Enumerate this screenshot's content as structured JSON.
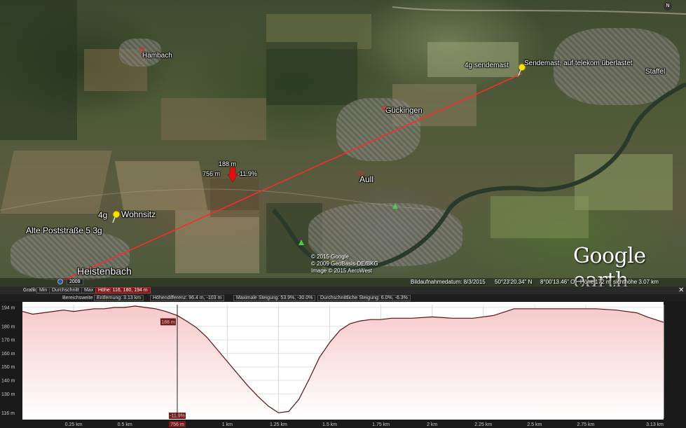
{
  "map": {
    "places": {
      "hambach": "Hambach",
      "gueckingen": "Gückingen",
      "aull": "Aull",
      "heistenbach": "Heistenbach",
      "staffel": "Staffel"
    },
    "placemarks": {
      "sendemast_small": "4g sendemast",
      "sendemast": "Sendemast, auf telekom überlastet",
      "wohnsitz_prefix": "4g",
      "wohnsitz": "Wohnsitz",
      "poststrasse": "Alte Poststraße 5 3g"
    },
    "cursor": {
      "height": "188 m",
      "distance": "756 m",
      "slope": "-11.9%"
    },
    "copyright": [
      "© 2015 Google",
      "© 2009 GeoBasis-DE/BKG",
      "Image © 2015 AeroWest"
    ],
    "logo": "Google earth",
    "north": "N",
    "year_badge": "2009",
    "status": {
      "date": "Bildaufnahmedatum: 8/3/2015",
      "lat": "50°23'20.34\" N",
      "lon": "8°00'13.46\" O",
      "elev": "Höhe  172 m",
      "eye": "sichthöhe    3.07 km"
    }
  },
  "profile": {
    "toolbar1": {
      "grafik": "Grafik:",
      "min": "Min",
      "avg": "Durchschnitt",
      "max": "Max",
      "hoehe": "Höhe: 116, 180, 194 m"
    },
    "toolbar2": {
      "bereich": "Bereichsweite",
      "entfernung": "Entfernung: 3.13 km",
      "hoehendiff": "Höhendifferenz: 96.4 m, -103 m",
      "maxsteigung": "Maximale Steigung: 53.9%, -30.0%",
      "avgsteigung": "Durchschnittliche Steigung: 6.0%, -6.3%"
    },
    "close": "✕",
    "cursor_height_label": "188 m",
    "cursor_distance_label": "756 m",
    "cursor_slope_label": "-11.9%"
  },
  "chart_data": {
    "type": "area",
    "title": "",
    "xlabel": "",
    "ylabel": "",
    "xlim": [
      0,
      3.13
    ],
    "ylim": [
      112,
      196
    ],
    "y_ticks": [
      {
        "v": 194,
        "label": "194 m"
      },
      {
        "v": 180,
        "label": "180 m"
      },
      {
        "v": 170,
        "label": "170 m"
      },
      {
        "v": 160,
        "label": "160 m"
      },
      {
        "v": 150,
        "label": "150 m"
      },
      {
        "v": 140,
        "label": "140 m"
      },
      {
        "v": 130,
        "label": "130 m"
      },
      {
        "v": 116,
        "label": "116 m"
      }
    ],
    "x_ticks": [
      {
        "v": 0.25,
        "label": "0.25 km"
      },
      {
        "v": 0.5,
        "label": "0.5 km"
      },
      {
        "v": 0.756,
        "label": "756 m"
      },
      {
        "v": 1.0,
        "label": "1 km"
      },
      {
        "v": 1.25,
        "label": "1.25 km"
      },
      {
        "v": 1.5,
        "label": "1.5 km"
      },
      {
        "v": 1.75,
        "label": "1.75 km"
      },
      {
        "v": 2.0,
        "label": "2 km"
      },
      {
        "v": 2.25,
        "label": "2.25 km"
      },
      {
        "v": 2.5,
        "label": "2.5 km"
      },
      {
        "v": 2.75,
        "label": "2.75 km"
      },
      {
        "v": 3.13,
        "label": "3.13 km"
      }
    ],
    "cursor_x": 0.756,
    "series": [
      {
        "x": [
          0,
          0.05,
          0.1,
          0.15,
          0.2,
          0.25,
          0.3,
          0.35,
          0.4,
          0.45,
          0.5,
          0.55,
          0.6,
          0.65,
          0.7,
          0.756,
          0.8,
          0.85,
          0.9,
          0.95,
          1.0,
          1.05,
          1.1,
          1.15,
          1.2,
          1.25,
          1.3,
          1.35,
          1.4,
          1.45,
          1.5,
          1.55,
          1.6,
          1.65,
          1.7,
          1.75,
          1.8,
          1.9,
          2.0,
          2.1,
          2.2,
          2.3,
          2.4,
          2.5,
          2.6,
          2.7,
          2.8,
          2.9,
          3.0,
          3.05,
          3.13
        ],
        "y": [
          191,
          189,
          190,
          191,
          192,
          191,
          192,
          193,
          193,
          194,
          194,
          195,
          194,
          193,
          191,
          188,
          184,
          179,
          172,
          163,
          154,
          145,
          136,
          128,
          121,
          116,
          117,
          126,
          141,
          157,
          168,
          177,
          182,
          184,
          185,
          185,
          186,
          186,
          187,
          186,
          186,
          188,
          193,
          193,
          193,
          193,
          193,
          192,
          190,
          187,
          183
        ]
      }
    ]
  }
}
